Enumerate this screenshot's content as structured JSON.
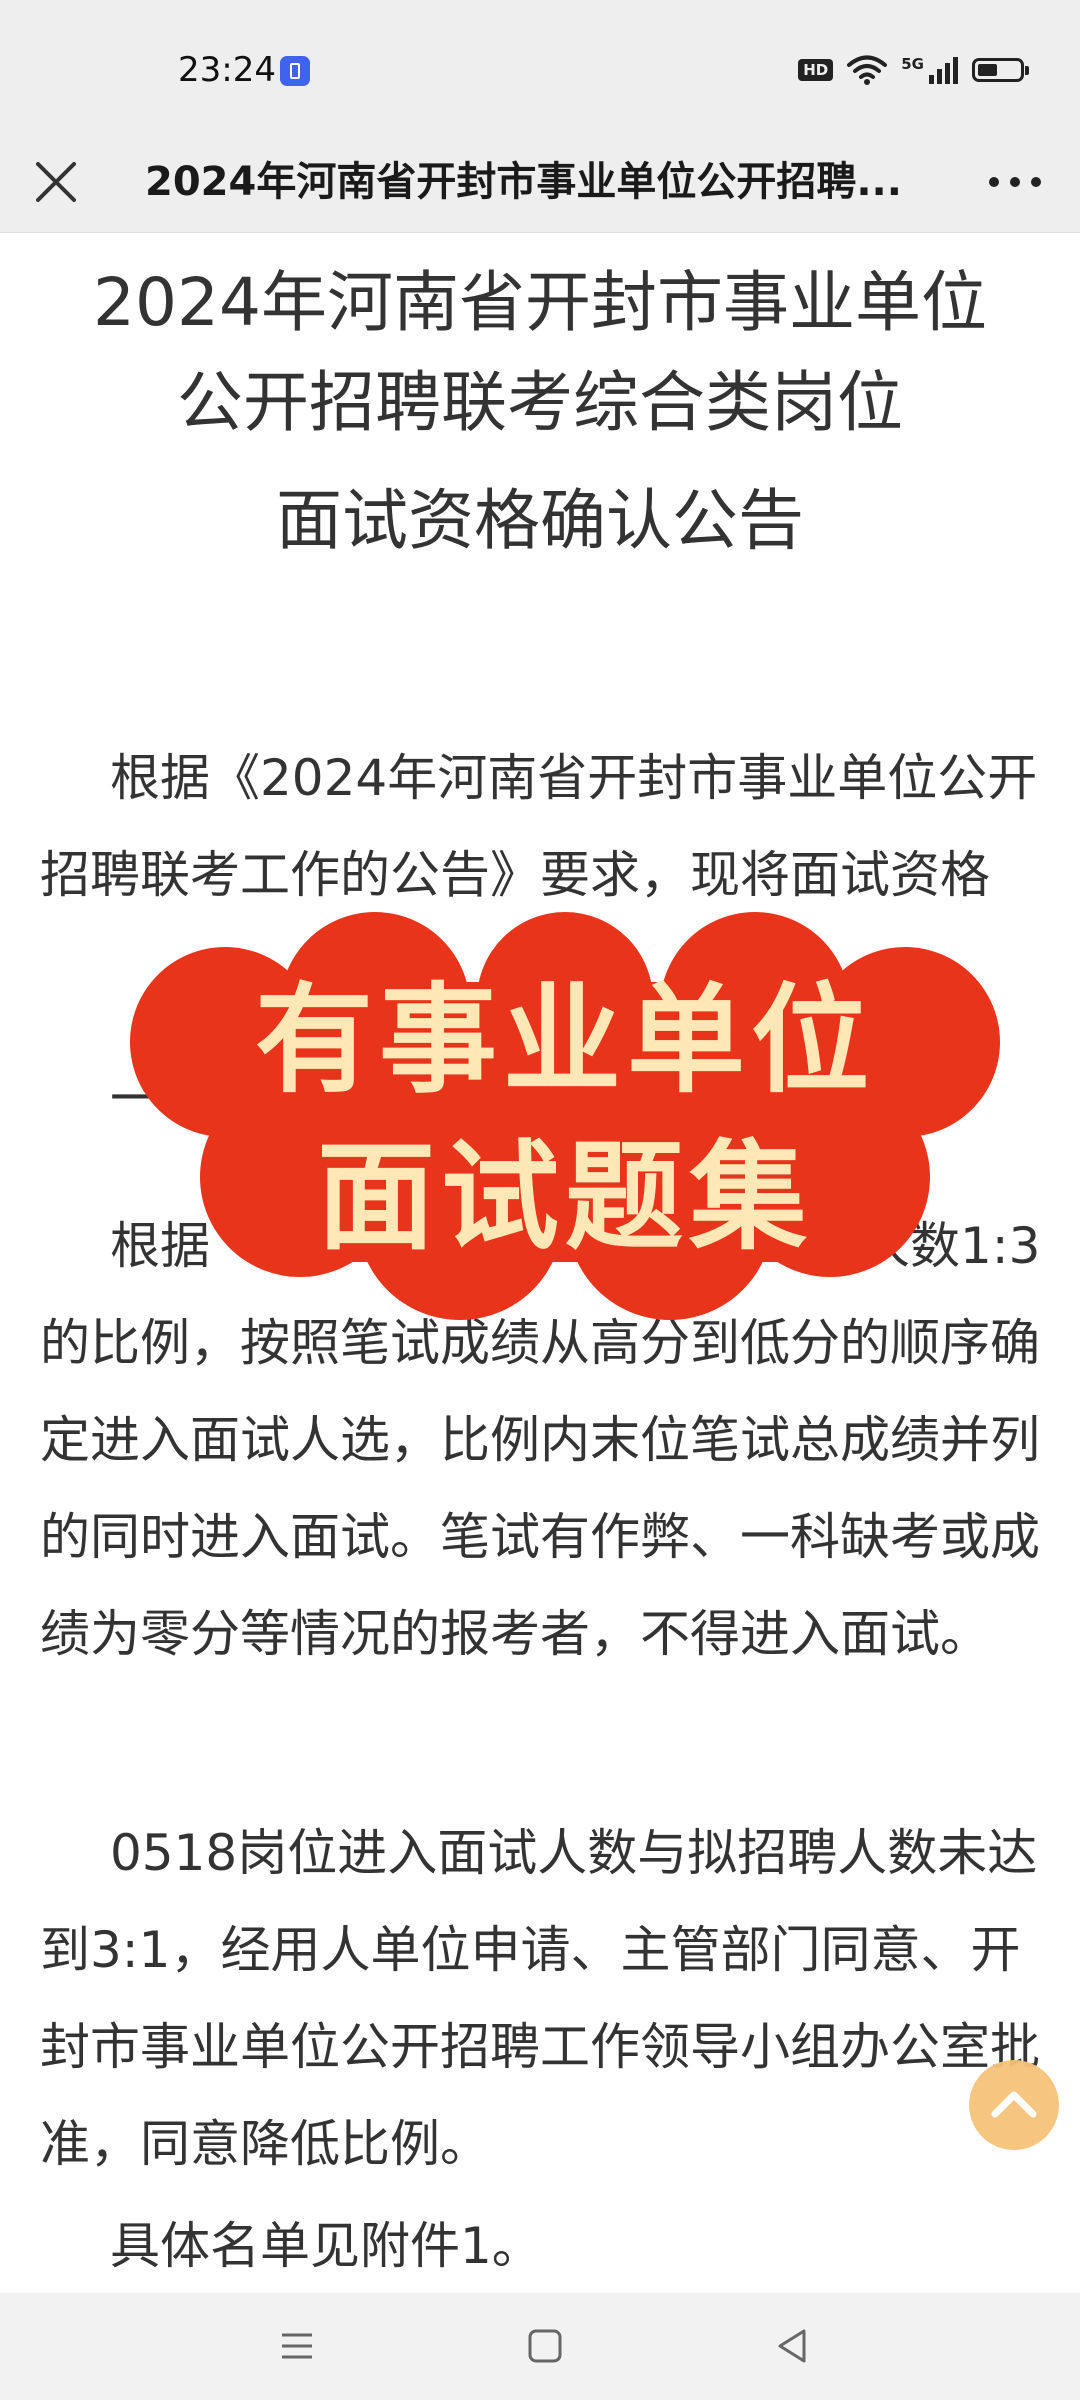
{
  "status_bar": {
    "time": "23:24",
    "hd_badge": "HD",
    "network": "5G",
    "icons": [
      "wifi-icon",
      "signal-icon",
      "battery-icon"
    ]
  },
  "title_bar": {
    "title": "2024年河南省开封市事业单位公开招聘...",
    "close_icon": "close-icon",
    "more_icon": "more-icon"
  },
  "article": {
    "title_line1": "2024年河南省开封市事业单位",
    "title_line2": "公开招聘联考综合类岗位",
    "title_line3": "面试资格确认公告",
    "paragraphs": [
      "根据《2024年河南省开封市事业单位公开招聘联考工作的公告》要求，现将面试资格",
      "一",
      "根据　　　　　　　　　　　　　人数1:3的比例，按照笔试成绩从高分到低分的顺序确定进入面试人选，比例内末位笔试总成绩并列的同时进入面试。笔试有作弊、一科缺考或成绩为零分等情况的报考者，不得进入面试。",
      "0518岗位进入面试人数与拟招聘人数未达到3:1，经用人单位申请、主管部门同意、开封市事业单位公开招聘工作领导小组办公室批准，同意降低比例。",
      "具体名单见附件1。"
    ]
  },
  "promo": {
    "line1": "有事业单位",
    "line2": "面试题集",
    "color": "#e8341a",
    "text_color": "#ffe8b6"
  },
  "navigation": {
    "icons": [
      "menu-icon",
      "home-icon",
      "back-icon"
    ]
  }
}
